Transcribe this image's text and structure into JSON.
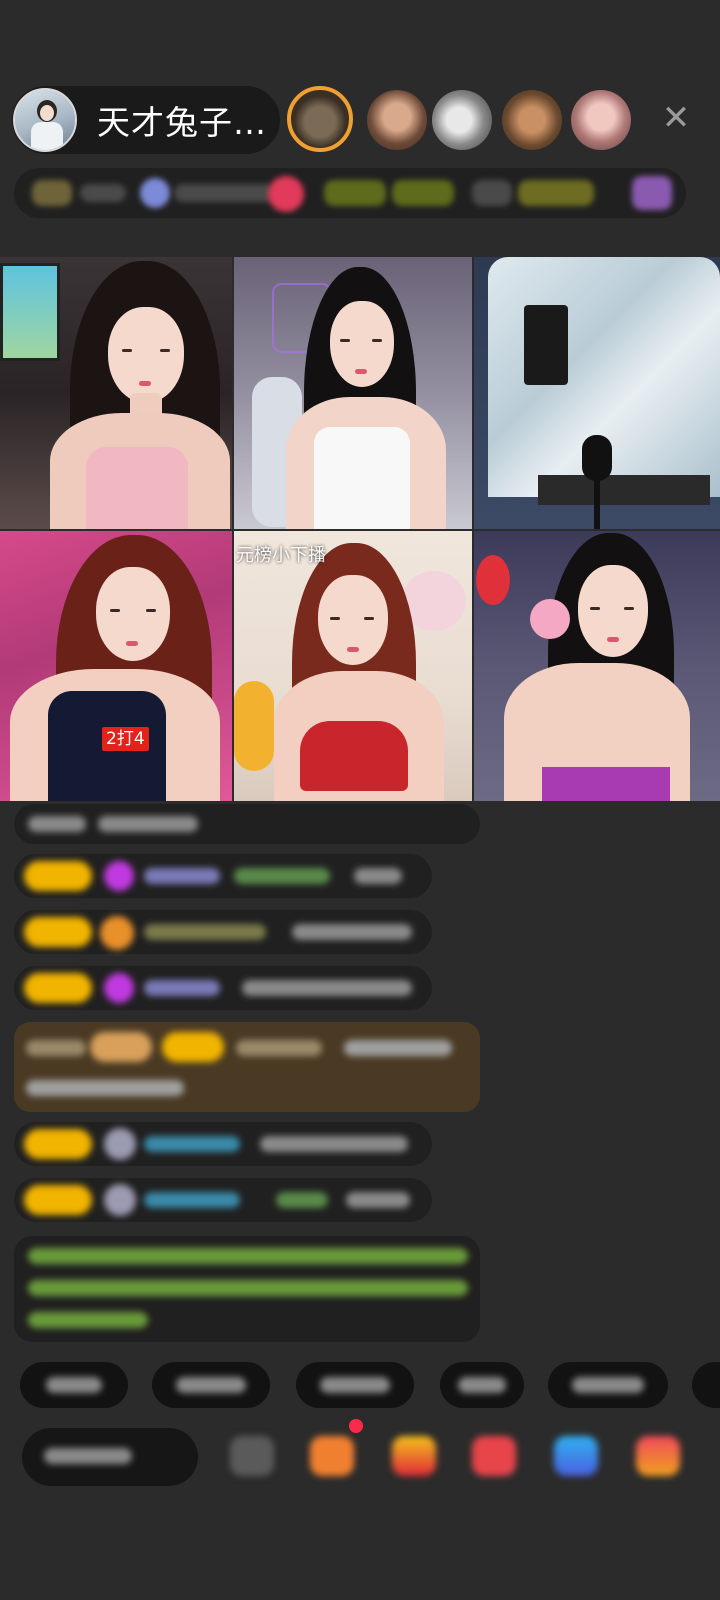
{
  "header": {
    "host_name": "天才兔子…",
    "close_icon": "close-icon"
  },
  "video_grid": {
    "tile_4_badge": "2打4",
    "tile_5_caption": "元榜小下播"
  },
  "chat": {
    "messages_count_visible": 8
  },
  "colors": {
    "background": "#2b2b2b",
    "badge_yellow": "#f1b400",
    "pill_dark": "#1a1a1a",
    "label_red": "#e2231a"
  }
}
